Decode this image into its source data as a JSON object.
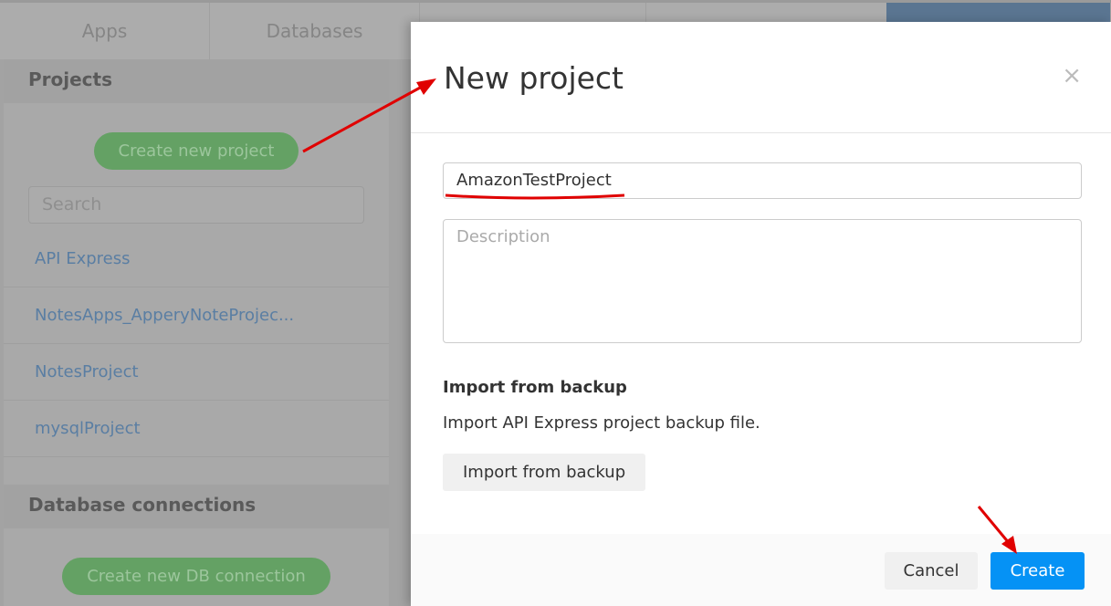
{
  "tabs": [
    "Apps",
    "Databases",
    "",
    ""
  ],
  "sidebar": {
    "projects_title": "Projects",
    "create_project": "Create new project",
    "search_placeholder": "Search",
    "projects": [
      "API Express",
      "NotesApps_ApperyNoteProjec...",
      "NotesProject",
      "mysqlProject"
    ],
    "db_title": "Database connections",
    "create_db": "Create new DB connection"
  },
  "modal": {
    "title": "New project",
    "close": "×",
    "name_value": "AmazonTestProject",
    "description_placeholder": "Description",
    "import_title": "Import from backup",
    "import_text": "Import API Express project backup file.",
    "import_button": "Import from backup",
    "cancel": "Cancel",
    "create": "Create"
  },
  "colors": {
    "primary": "#0592f5",
    "annotation": "#e00000"
  }
}
